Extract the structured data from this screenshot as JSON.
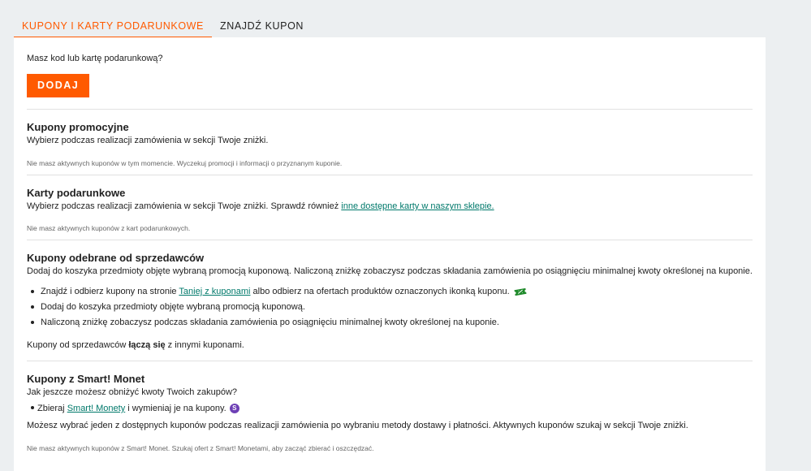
{
  "tabs": [
    {
      "label": "KUPONY I KARTY PODARUNKOWE",
      "active": true
    },
    {
      "label": "ZNAJDŹ KUPON",
      "active": false
    }
  ],
  "add_code": {
    "question": "Masz kod lub kartę podarunkową?",
    "button": "DODAJ"
  },
  "promo": {
    "title": "Kupony promocyjne",
    "desc": "Wybierz podczas realizacji zamówienia w sekcji Twoje zniżki.",
    "note": "Nie masz aktywnych kuponów w tym momencie. Wyczekuj promocji i informacji o przyznanym kuponie."
  },
  "gift": {
    "title": "Karty podarunkowe",
    "desc": "Wybierz podczas realizacji zamówienia w sekcji Twoje zniżki. Sprawdź również ",
    "link": "inne dostępne karty w naszym sklepie.",
    "note": "Nie masz aktywnych kuponów z kart podarunkowych."
  },
  "seller": {
    "title": "Kupony odebrane od sprzedawców",
    "desc": "Dodaj do koszyka przedmioty objęte wybraną promocją kuponową. Naliczoną zniżkę zobaczysz podczas składania zamówienia po osiągnięciu minimalnej kwoty określonej na kuponie.",
    "b1_pre": "Znajdź i odbierz kupony na stronie ",
    "b1_link": "Taniej z kuponami",
    "b1_post": " albo odbierz na ofertach produktów oznaczonych ikonką kuponu.",
    "b2": "Dodaj do koszyka przedmioty objęte wybraną promocją kuponową.",
    "b3": "Naliczoną zniżkę zobaczysz podczas składania zamówienia po osiągnięciu minimalnej kwoty określonej na kuponie.",
    "combine_pre": "Kupony od sprzedawców ",
    "combine_bold": "łączą się",
    "combine_post": " z innymi kuponami."
  },
  "smart": {
    "title": "Kupony z Smart! Monet",
    "desc": "Jak jeszcze możesz obniżyć kwoty Twoich zakupów?",
    "b1_pre": "Zbieraj ",
    "b1_link": "Smart! Monety",
    "b1_post": " i wymieniaj je na kupony.",
    "badge": "S",
    "info": "Możesz wybrać jeden z dostępnych kuponów podczas realizacji zamówienia po wybraniu metody dostawy i płatności. Aktywnych kuponów szukaj w sekcji Twoje zniżki.",
    "note": "Nie masz aktywnych kuponów z Smart! Monet. Szukaj ofert z Smart! Monetami, aby zacząć zbierać i oszczędzać."
  },
  "colors": {
    "accent": "#ff5a00",
    "link": "#00796b",
    "coupon_icon": "#1f8a2b",
    "smart_badge": "#6d3fb5"
  }
}
